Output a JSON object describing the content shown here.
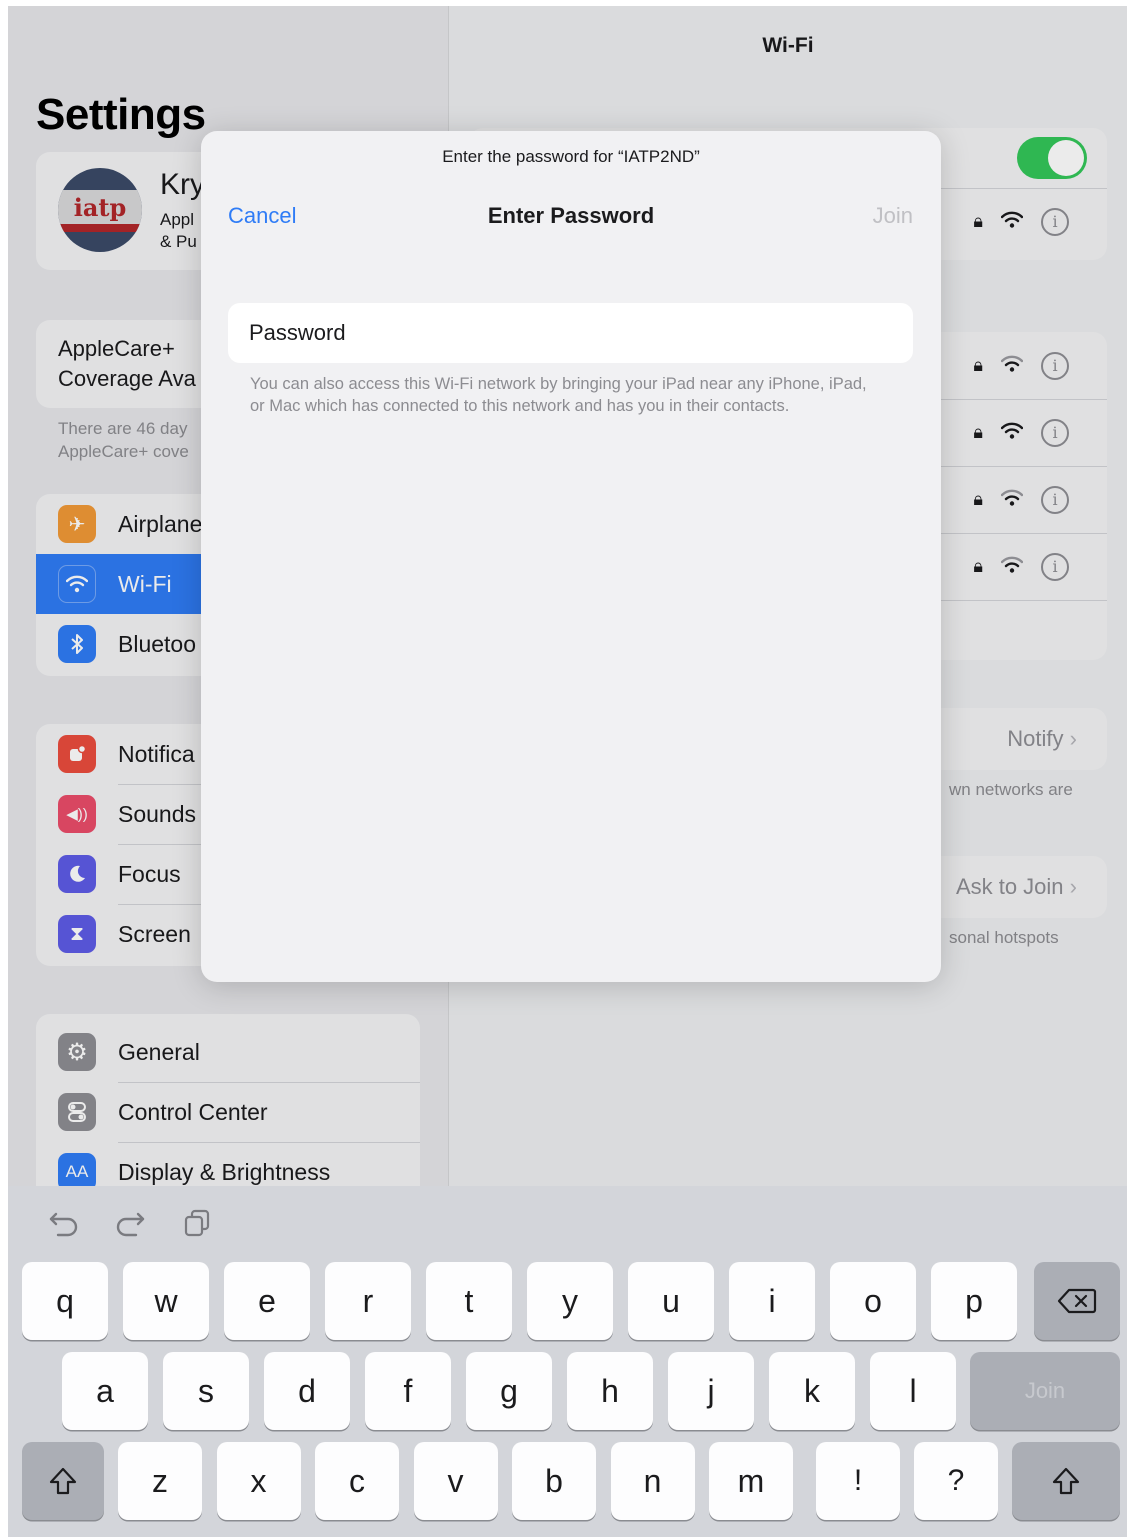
{
  "settings": {
    "title": "Settings",
    "profile": {
      "name": "Kry",
      "sub1": "Appl",
      "sub2": "& Pu",
      "avatar_text": "iatp"
    },
    "applecare": {
      "line1": "AppleCare+",
      "line2": "Coverage Ava",
      "note1": "There are 46 day",
      "note2": "AppleCare+ cove"
    },
    "group1": [
      {
        "label": "Airplane",
        "icon": "airplane-icon",
        "color": "#f19a37"
      },
      {
        "label": "Wi-Fi",
        "icon": "wifi-icon",
        "color": "#2f7cf6"
      },
      {
        "label": "Bluetoo",
        "icon": "bluetooth-icon",
        "color": "#2f7cf6"
      }
    ],
    "group2": [
      {
        "label": "Notifica",
        "icon": "notifications-icon",
        "color": "#eb4d3d"
      },
      {
        "label": "Sounds",
        "icon": "sounds-icon",
        "color": "#eb4d6a"
      },
      {
        "label": "Focus",
        "icon": "focus-moon-icon",
        "color": "#5e5ce6"
      },
      {
        "label": "Screen",
        "icon": "screen-time-icon",
        "color": "#5e5ce6"
      }
    ],
    "group3": [
      {
        "label": "General",
        "icon": "gear-icon",
        "color": "#8e8e93"
      },
      {
        "label": "Control Center",
        "icon": "control-center-icon",
        "color": "#8e8e93"
      },
      {
        "label": "Display & Brightness",
        "icon": "display-brightness-icon",
        "color": "#2f7cf6",
        "glyph": "AA"
      }
    ]
  },
  "wifi": {
    "title": "Wi-Fi",
    "ask_notify": "Notify",
    "ask_notify_note": "wn networks are",
    "auto_join": "Ask to Join",
    "auto_join_note": "sonal hotspots"
  },
  "modal": {
    "prompt": "Enter the password for “IATP2ND”",
    "cancel": "Cancel",
    "title": "Enter Password",
    "join": "Join",
    "password_placeholder": "Password",
    "note": "You can also access this Wi-Fi network by bringing your iPad near any iPhone, iPad, or Mac which has connected to this network and has you in their contacts."
  },
  "keyboard": {
    "row1": [
      "q",
      "w",
      "e",
      "r",
      "t",
      "y",
      "u",
      "i",
      "o",
      "p"
    ],
    "row2": [
      "a",
      "s",
      "d",
      "f",
      "g",
      "h",
      "j",
      "k",
      "l"
    ],
    "row3": [
      "z",
      "x",
      "c",
      "v",
      "b",
      "n",
      "m"
    ],
    "punct1": "!",
    "punct2": "?",
    "join": "Join"
  },
  "colors": {
    "accent": "#2f7cf6",
    "toggle_on": "#34c759",
    "selected_row": "#2f7cf6"
  }
}
